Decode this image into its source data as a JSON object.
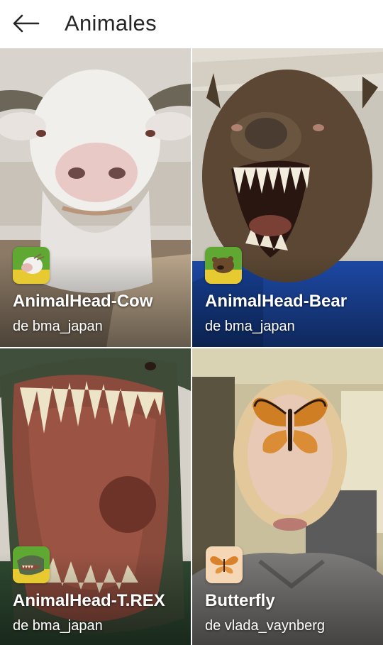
{
  "header": {
    "back_icon": "arrow-left-icon",
    "title": "Animales"
  },
  "effects": [
    {
      "name": "AnimalHead-Cow",
      "author": "de bma_japan",
      "icon": "cow-icon"
    },
    {
      "name": "AnimalHead-Bear",
      "author": "de bma_japan",
      "icon": "bear-icon"
    },
    {
      "name": "AnimalHead-T.REX",
      "author": "de bma_japan",
      "icon": "trex-icon"
    },
    {
      "name": "Butterfly",
      "author": "de vlada_vaynberg",
      "icon": "butterfly-icon"
    }
  ]
}
